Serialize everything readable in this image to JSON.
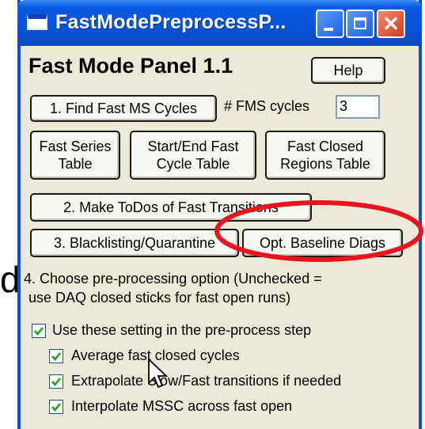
{
  "window": {
    "title": "FastModePreprocessP...",
    "buttons": {
      "minimize": "minimize",
      "maximize": "maximize",
      "close": "✕"
    }
  },
  "panel": {
    "title": "Fast Mode Panel 1.1",
    "help_label": "Help",
    "find_cycles_label": "1. Find Fast MS Cycles",
    "fms_cycles_label": "# FMS cycles",
    "fms_cycles_value": "3",
    "fast_series_label": "Fast Series Table",
    "fast_series_line1": "Fast Series",
    "fast_series_line2": "Table",
    "start_end_line1": "Start/End Fast",
    "start_end_line2": "Cycle Table",
    "closed_regions_line1": "Fast Closed",
    "closed_regions_line2": "Regions Table",
    "make_todos_label": "2. Make ToDos of Fast Transitions",
    "blacklisting_label": "3. Blacklisting/Quarantine",
    "opt_baseline_label": "Opt. Baseline Diags",
    "option_line1": "4. Choose pre-processing option (Unchecked =",
    "option_line2": "use DAQ closed sticks for fast open runs)",
    "checkboxes": [
      {
        "label": "Use these setting in the pre-process step",
        "checked": true
      },
      {
        "label": "Average fast closed cycles",
        "checked": true
      },
      {
        "label": "Extrapolate Slow/Fast transitions if needed",
        "checked": true
      },
      {
        "label": "Interpolate MSSC across fast open",
        "checked": true
      }
    ]
  },
  "outside_text": "d",
  "colors": {
    "title_bar": "#0654d6",
    "window_bg": "#ece9d8",
    "highlight": "#e8141e",
    "check": "#21a121"
  }
}
